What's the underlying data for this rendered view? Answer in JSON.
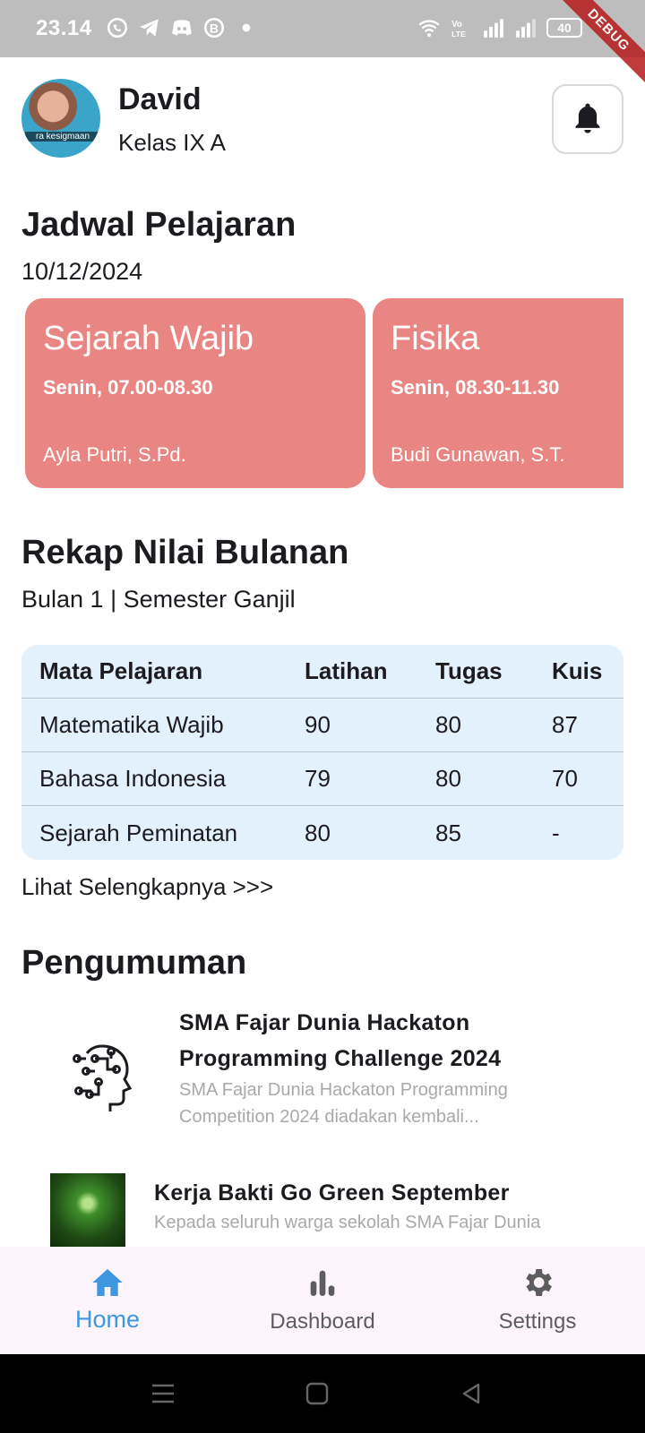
{
  "status_bar": {
    "time": "23.14",
    "battery": "40",
    "debug_label": "DEBUG"
  },
  "header": {
    "name": "David",
    "class_label": "Kelas IX A",
    "avatar_caption": "ra kesigmaan"
  },
  "schedule": {
    "title": "Jadwal Pelajaran",
    "date": "10/12/2024",
    "cards": [
      {
        "subject": "Sejarah Wajib",
        "time": "Senin, 07.00-08.30",
        "teacher": "Ayla Putri, S.Pd."
      },
      {
        "subject": "Fisika",
        "time": "Senin, 08.30-11.30",
        "teacher": "Budi Gunawan, S.T."
      }
    ],
    "card_color": "#e98683"
  },
  "grades": {
    "title": "Rekap Nilai Bulanan",
    "subtitle": "Bulan 1 | Semester Ganjil",
    "headers": [
      "Mata Pelajaran",
      "Latihan",
      "Tugas",
      "Kuis"
    ],
    "rows": [
      [
        "Matematika Wajib",
        "90",
        "80",
        "87"
      ],
      [
        "Bahasa Indonesia",
        "79",
        "80",
        "70"
      ],
      [
        "Sejarah Peminatan",
        "80",
        "85",
        "-"
      ]
    ],
    "more_link": "Lihat Selengkapnya >>>"
  },
  "announcements": {
    "title": "Pengumuman",
    "items": [
      {
        "icon": "ai-head-icon",
        "title": "SMA Fajar Dunia Hackaton Programming Challenge 2024",
        "desc": "SMA Fajar Dunia Hackaton Programming Competition 2024 diadakan kembali..."
      },
      {
        "icon": "tree-image",
        "title": "Kerja Bakti Go Green September",
        "desc": "Kepada seluruh warga sekolah SMA Fajar Dunia"
      }
    ]
  },
  "bottom_nav": {
    "items": [
      {
        "label": "Home",
        "icon": "home-icon",
        "active": true
      },
      {
        "label": "Dashboard",
        "icon": "bar-chart-icon",
        "active": false
      },
      {
        "label": "Settings",
        "icon": "gear-icon",
        "active": false
      }
    ],
    "active_color": "#3e97e0"
  }
}
